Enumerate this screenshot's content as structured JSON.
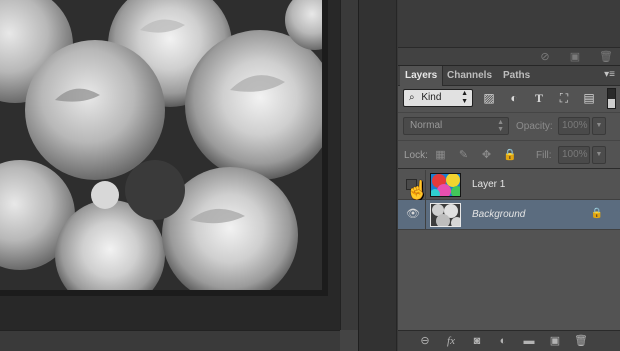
{
  "canvas": {
    "image_name": "roses-grayscale-image"
  },
  "top_panel": {
    "icons": [
      "no-icon",
      "new-icon",
      "trash-icon"
    ]
  },
  "layers_panel": {
    "tabs": [
      {
        "label": "Layers",
        "active": true
      },
      {
        "label": "Channels",
        "active": false
      },
      {
        "label": "Paths",
        "active": false
      }
    ],
    "filter": {
      "kind_label": "Kind",
      "icons": [
        "image-filter-icon",
        "adjustment-filter-icon",
        "type-filter-icon",
        "shape-filter-icon",
        "smart-object-filter-icon"
      ]
    },
    "blend_mode": "Normal",
    "opacity_label": "Opacity:",
    "opacity_value": "100%",
    "lock_label": "Lock:",
    "fill_label": "Fill:",
    "fill_value": "100%",
    "layers": [
      {
        "name": "Layer 1",
        "visible": false,
        "selected": false,
        "locked": false
      },
      {
        "name": "Background",
        "visible": true,
        "selected": true,
        "locked": true
      }
    ],
    "bottom_icons": [
      "link-icon",
      "fx-icon",
      "mask-icon",
      "adjustment-icon",
      "folder-icon",
      "new-layer-icon",
      "delete-icon"
    ]
  },
  "colors": {
    "selected_layer": "#5b6c7f",
    "panel_bg": "#535353"
  }
}
